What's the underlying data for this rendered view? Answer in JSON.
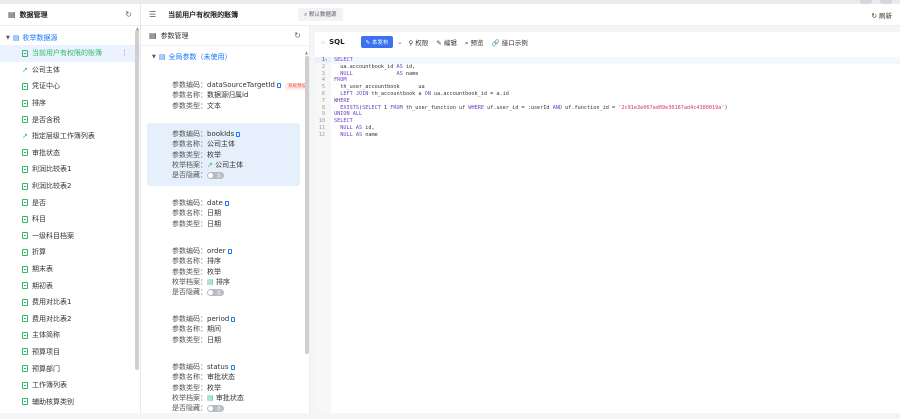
{
  "sidebar": {
    "title": "数据管理",
    "root_label": "枚举数据源",
    "items": [
      {
        "label": "当前用户有权限的账簿",
        "type": "table",
        "active": true
      },
      {
        "label": "公司主体",
        "type": "link"
      },
      {
        "label": "凭证中心",
        "type": "table"
      },
      {
        "label": "排序",
        "type": "table"
      },
      {
        "label": "是否含税",
        "type": "table"
      },
      {
        "label": "指定层级工作簿列表",
        "type": "link"
      },
      {
        "label": "审批状态",
        "type": "table"
      },
      {
        "label": "利润比较表1",
        "type": "table"
      },
      {
        "label": "利润比较表2",
        "type": "table"
      },
      {
        "label": "是否",
        "type": "table"
      },
      {
        "label": "科目",
        "type": "table"
      },
      {
        "label": "一级科目档案",
        "type": "table"
      },
      {
        "label": "折算",
        "type": "table"
      },
      {
        "label": "期末表",
        "type": "table"
      },
      {
        "label": "期初表",
        "type": "table"
      },
      {
        "label": "费用对比表1",
        "type": "table"
      },
      {
        "label": "费用对比表2",
        "type": "table"
      },
      {
        "label": "主体简称",
        "type": "table"
      },
      {
        "label": "预算项目",
        "type": "table"
      },
      {
        "label": "预算部门",
        "type": "table"
      },
      {
        "label": "工作簿列表",
        "type": "table"
      },
      {
        "label": "辅助核算类别",
        "type": "table"
      }
    ]
  },
  "header": {
    "title": "当前用户有权限的账簿",
    "datasource": "默认数据源",
    "refresh": "刷新"
  },
  "params": {
    "title": "参数管理",
    "group_label": "全局参数（未使用）",
    "labels": {
      "code": "参数编码：",
      "name": "参数名称：",
      "type": "参数类型：",
      "archive": "枚举档案：",
      "hidden": "是否隐藏："
    },
    "toggle_off": "否",
    "cards": [
      {
        "code": "dataSourceTargetId",
        "tag": "系统预设",
        "name": "数据源归属id",
        "type": "文本"
      },
      {
        "code": "bookIds",
        "name": "公司主体",
        "type": "枚举",
        "archive": "公司主体",
        "archive_icon": "link",
        "hidden": true,
        "selected": true
      },
      {
        "code": "date",
        "name": "日期",
        "type": "日期"
      },
      {
        "code": "order",
        "name": "排序",
        "type": "枚举",
        "archive": "排序",
        "archive_icon": "table",
        "hidden": true
      },
      {
        "code": "period",
        "name": "期间",
        "type": "日期"
      },
      {
        "code": "status",
        "name": "审批状态",
        "type": "枚举",
        "archive": "审批状态",
        "archive_icon": "table",
        "hidden": true
      }
    ]
  },
  "sql": {
    "label": "SQL",
    "publish": "本发布",
    "actions": [
      "权限",
      "编辑",
      "预览",
      "接口示例"
    ],
    "lines": [
      "SELECT",
      "  ua.accountbook_id AS id,",
      "  NULL              AS name",
      "FROM",
      "  th_user_accountbook      ua",
      "  LEFT JOIN th_accountbook a ON ua.accountbook_id = a.id",
      "WHERE",
      "  EXISTS(SELECT 1 FROM th_user_function uf WHERE uf.user_id = :userId AND uf.function_id = '2c91e3e067ad09e30167ad4c4380019a')",
      "UNION ALL",
      "SELECT",
      "  NULL AS id,",
      "  NULL AS name"
    ]
  }
}
